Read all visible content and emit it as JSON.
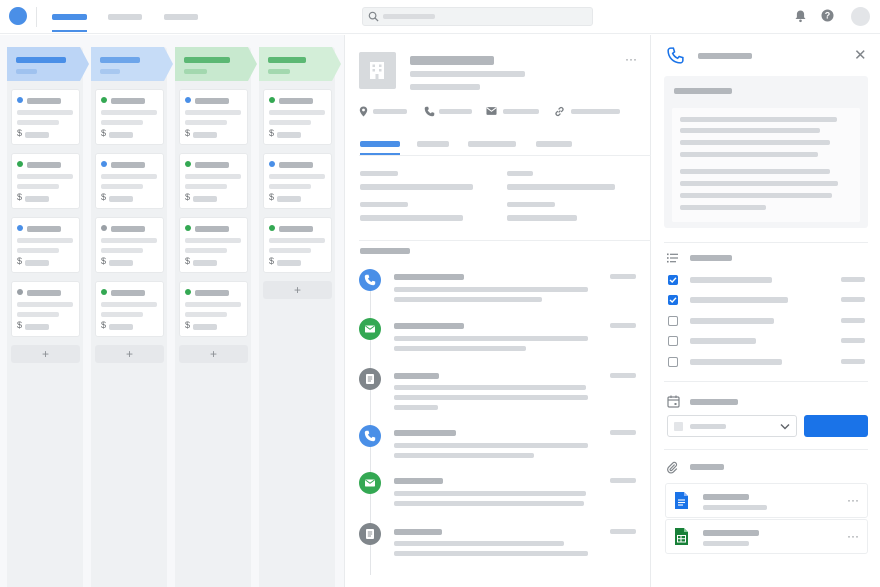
{
  "app": {
    "colors": {
      "accent": "#1a73e8",
      "nav_accent": "#4a8fe7",
      "stage_blue": "#bcd5f6",
      "stage_green": "#cdecd3",
      "dot_blue": "#4a8fe7",
      "dot_green": "#34a853",
      "dot_gray": "#9aa0a6"
    }
  },
  "topbar": {
    "logo_icon": "circle-logo",
    "nav_tabs": [
      {
        "label": "",
        "active": true
      },
      {
        "label": "",
        "active": false
      },
      {
        "label": "",
        "active": false
      }
    ],
    "search": {
      "placeholder": "",
      "value": ""
    },
    "icons": [
      "bell-icon",
      "help-icon",
      "avatar"
    ]
  },
  "board": {
    "stages": [
      {
        "name": "",
        "color": "blue"
      },
      {
        "name": "",
        "color": "blue"
      },
      {
        "name": "",
        "color": "green"
      },
      {
        "name": "",
        "color": "green"
      }
    ],
    "currency_symbol": "$",
    "add_symbol": "+",
    "card_dots": [
      [
        "blue",
        "green",
        "blue",
        "gray"
      ],
      [
        "green",
        "blue",
        "gray",
        "green"
      ],
      [
        "blue",
        "green",
        "green",
        "green"
      ],
      [
        "green",
        "blue",
        "green"
      ]
    ]
  },
  "detail": {
    "more_symbol": "···",
    "info_icons": [
      "location-icon",
      "phone-icon",
      "mail-icon",
      "link-icon"
    ],
    "tabs": [
      {
        "label": "",
        "active": true
      },
      {
        "label": "",
        "active": false
      },
      {
        "label": "",
        "active": false
      },
      {
        "label": "",
        "active": false
      }
    ],
    "timeline_types": [
      "call",
      "email",
      "note",
      "call",
      "email",
      "note"
    ]
  },
  "panel": {
    "close_symbol": "✕",
    "checklist": [
      true,
      true,
      false,
      false,
      false
    ],
    "save_label": "",
    "files": [
      {
        "type": "doc",
        "color": "#1a73e8"
      },
      {
        "type": "sheet",
        "color": "#188038"
      }
    ],
    "more_symbol": "···"
  }
}
